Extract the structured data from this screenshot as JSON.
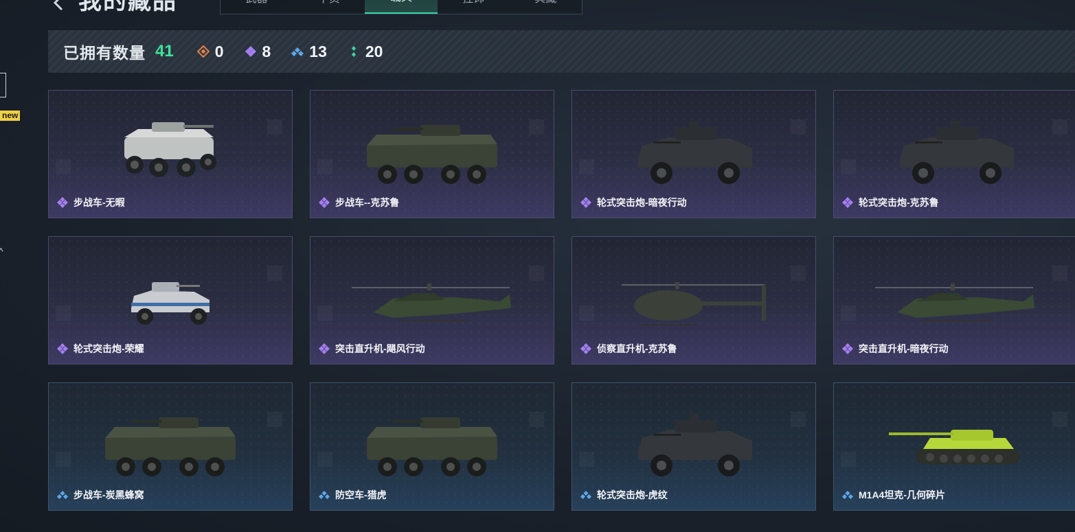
{
  "header": {
    "title": "我的藏品",
    "tabs": [
      {
        "label": "武器",
        "active": false
      },
      {
        "label": "干员",
        "active": false
      },
      {
        "label": "载具",
        "active": true
      },
      {
        "label": "挂饰",
        "active": false
      },
      {
        "label": "典藏",
        "active": false
      }
    ]
  },
  "sidebar": {
    "new_badge": "new"
  },
  "summary": {
    "owned_label": "已拥有数量",
    "owned_total": "41",
    "counts": [
      {
        "icon": "orange-diamond-icon",
        "value": "0",
        "color": "#e0804a"
      },
      {
        "icon": "purple-diamond-icon",
        "value": "8",
        "color": "#a57ff0"
      },
      {
        "icon": "blue-diamond-icon",
        "value": "13",
        "color": "#5fa8ea"
      },
      {
        "icon": "green-diamond-icon",
        "value": "20",
        "color": "#3ed6a0"
      }
    ]
  },
  "colors": {
    "accent": "#3ee39b",
    "purple_rarity": "#a57ff0",
    "blue_rarity": "#5fa8ea"
  },
  "items": [
    {
      "name": "步战车-无暇",
      "rarity": "purple",
      "kind": "ifv6"
    },
    {
      "name": "步战车--克苏鲁",
      "rarity": "purple",
      "kind": "ifv8"
    },
    {
      "name": "轮式突击炮-暗夜行动",
      "rarity": "purple",
      "kind": "car4"
    },
    {
      "name": "轮式突击炮-克苏鲁",
      "rarity": "purple",
      "kind": "car4"
    },
    {
      "name": "轮式突击炮-荣耀",
      "rarity": "purple",
      "kind": "buggy"
    },
    {
      "name": "突击直升机-飓风行动",
      "rarity": "purple",
      "kind": "heli"
    },
    {
      "name": "侦察直升机-克苏鲁",
      "rarity": "purple",
      "kind": "heli_scout"
    },
    {
      "name": "突击直升机-暗夜行动",
      "rarity": "purple",
      "kind": "heli"
    },
    {
      "name": "步战车-炭黑蜂窝",
      "rarity": "blue",
      "kind": "ifv8"
    },
    {
      "name": "防空车-猎虎",
      "rarity": "blue",
      "kind": "ifv8"
    },
    {
      "name": "轮式突击炮-虎纹",
      "rarity": "blue",
      "kind": "car4"
    },
    {
      "name": "M1A4坦克-几何碎片",
      "rarity": "blue",
      "kind": "tank"
    }
  ]
}
